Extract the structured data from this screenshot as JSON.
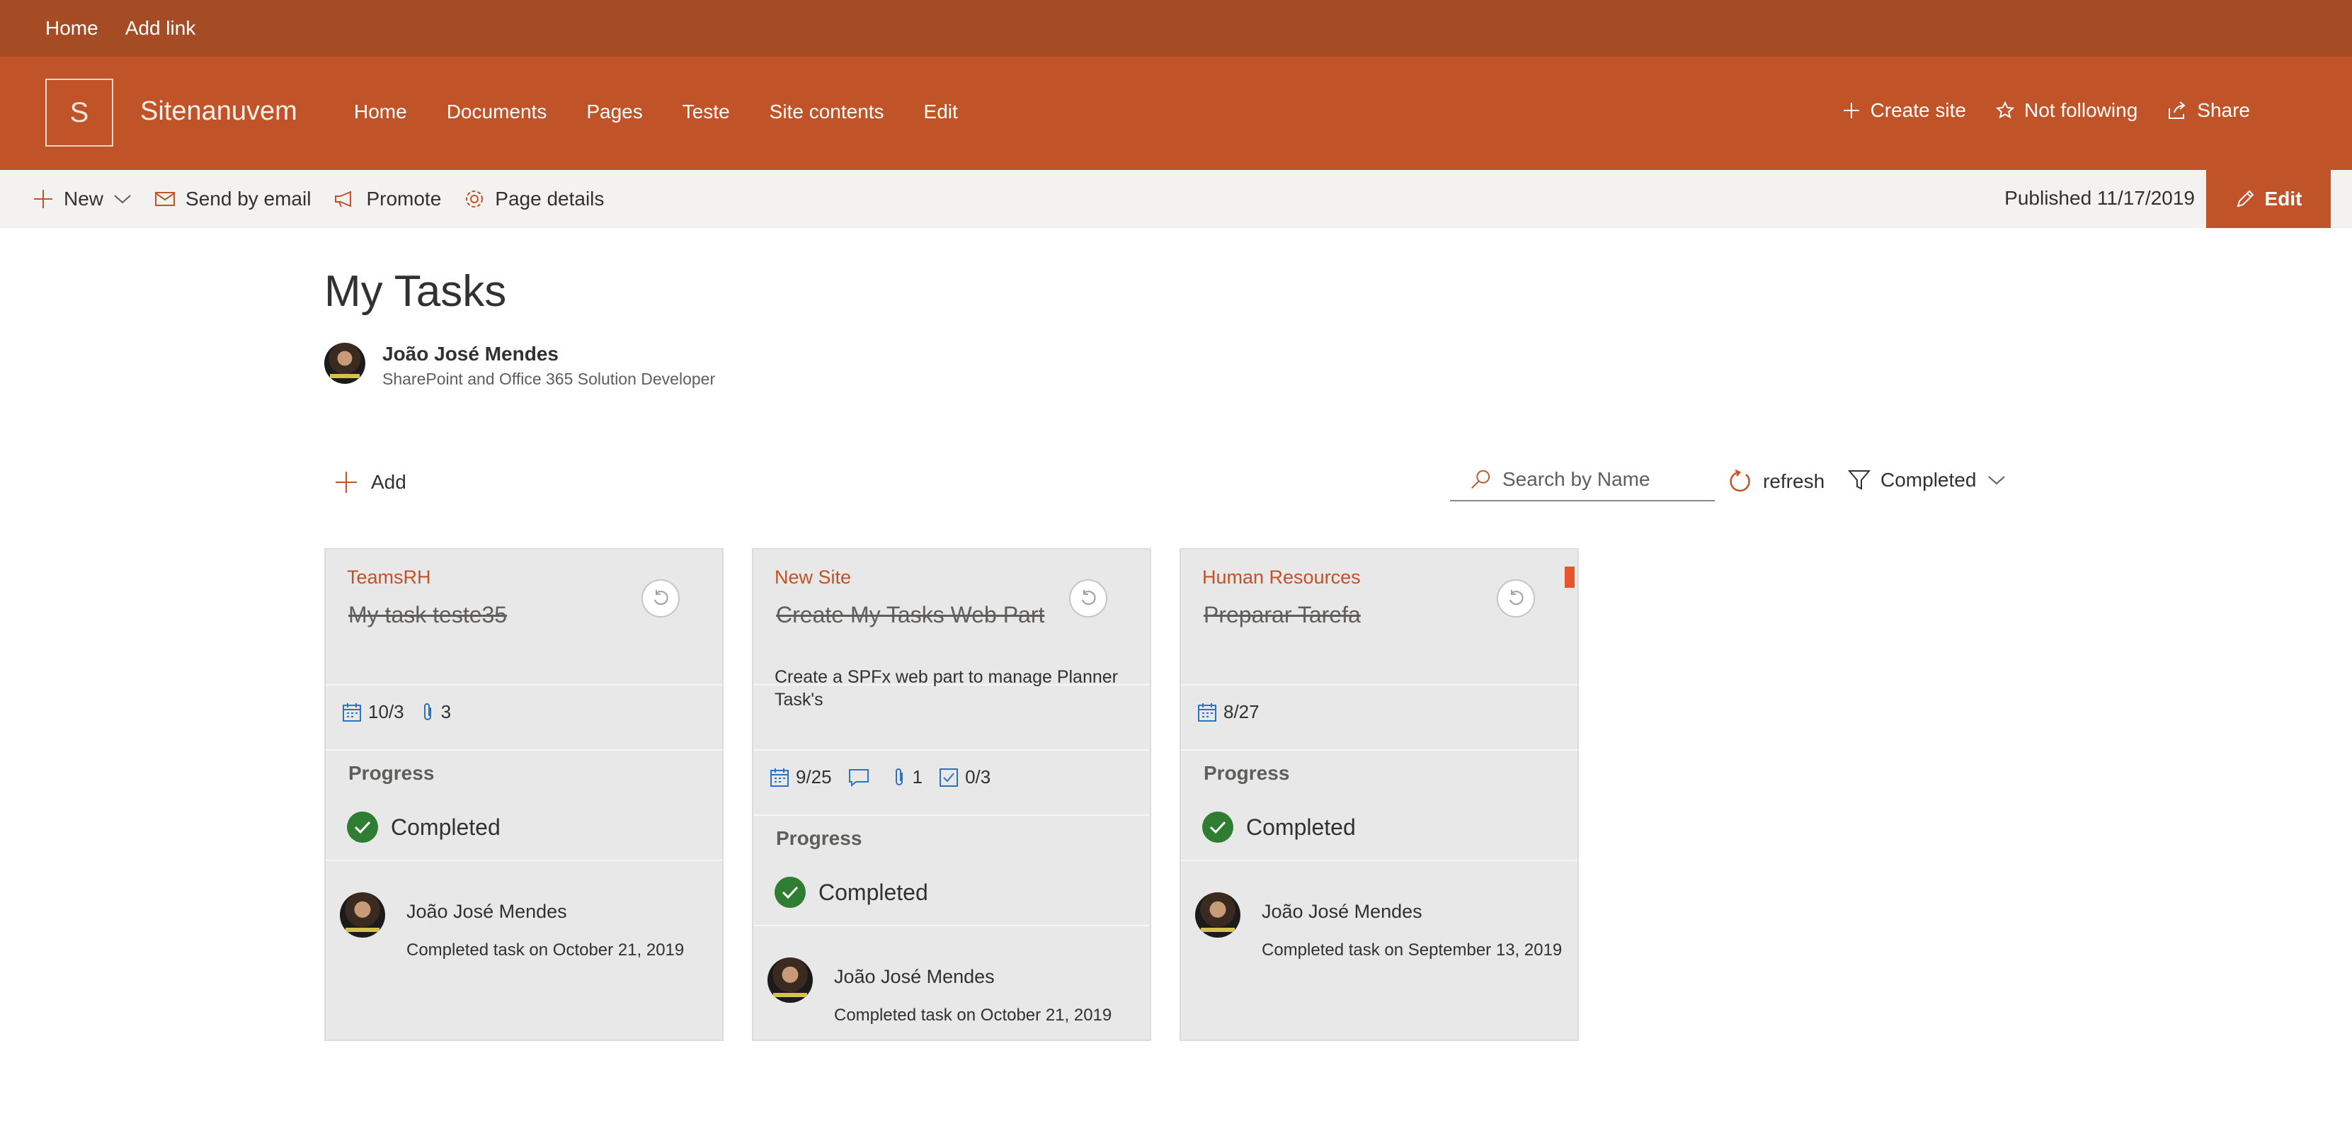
{
  "suite_bar": {
    "links": [
      "Home",
      "Add link"
    ]
  },
  "site": {
    "logo_letter": "S",
    "title": "Sitenanuvem",
    "nav": [
      "Home",
      "Documents",
      "Pages",
      "Teste",
      "Site contents",
      "Edit"
    ],
    "actions": {
      "create_site": "Create site",
      "follow": "Not following",
      "share": "Share"
    }
  },
  "command_bar": {
    "new": "New",
    "send_email": "Send by email",
    "promote": "Promote",
    "page_details": "Page details",
    "published": "Published 11/17/2019",
    "edit": "Edit"
  },
  "page": {
    "title": "My Tasks",
    "author": {
      "name": "João José Mendes",
      "role": "SharePoint and Office 365 Solution Developer"
    }
  },
  "toolbar": {
    "add": "Add",
    "search_placeholder": "Search by Name",
    "refresh": "refresh",
    "filter": "Completed"
  },
  "colors": {
    "accent": "#c05328",
    "suite": "#a64c24",
    "card_bg": "#e8e8e8",
    "completed": "#2f7d32",
    "flag": "#e8542c"
  },
  "tasks": [
    {
      "bucket": "TeamsRH",
      "title": "My task teste35",
      "description": "",
      "due": "10/3",
      "comments": "",
      "attachments": "3",
      "checklist": "",
      "progress_label": "Progress",
      "status": "Completed",
      "assignee": "João José Mendes",
      "completed_on": "Completed task on October 21, 2019"
    },
    {
      "bucket": "New Site",
      "title": "Create My Tasks Web Part",
      "description": "Create a SPFx web part to manage Planner Task's",
      "due": "9/25",
      "comments": "",
      "attachments": "1",
      "checklist": "0/3",
      "progress_label": "Progress",
      "status": "Completed",
      "assignee": "João José Mendes",
      "completed_on": "Completed task on October 21, 2019"
    },
    {
      "bucket": "Human Resources",
      "title": "Preparar Tarefa",
      "description": "",
      "due": "8/27",
      "comments": "",
      "attachments": "",
      "checklist": "",
      "progress_label": "Progress",
      "status": "Completed",
      "assignee": "João José Mendes",
      "completed_on": "Completed task on September 13, 2019"
    }
  ]
}
